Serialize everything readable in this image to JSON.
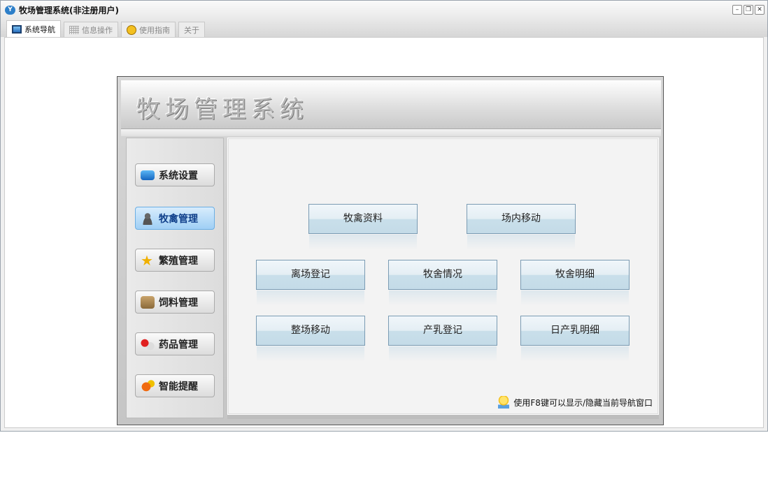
{
  "window": {
    "title": "牧场管理系统(非注册用户)",
    "controls": [
      "minimize",
      "restore",
      "close"
    ]
  },
  "tabs": [
    {
      "label": "系统导航",
      "icon": "monitor-icon",
      "active": true
    },
    {
      "label": "信息操作",
      "icon": "grid-icon",
      "active": false
    },
    {
      "label": "使用指南",
      "icon": "help-icon",
      "active": false
    },
    {
      "label": "关于",
      "active": false
    }
  ],
  "banner": {
    "title": "牧场管理系统"
  },
  "sidebar": {
    "items": [
      {
        "label": "系统设置",
        "icon": "monitor-icon"
      },
      {
        "label": "牧禽管理",
        "icon": "user-icon",
        "active": true
      },
      {
        "label": "繁殖管理",
        "icon": "star-icon"
      },
      {
        "label": "饲料管理",
        "icon": "box-icon"
      },
      {
        "label": "药品管理",
        "icon": "pill-icon"
      },
      {
        "label": "智能提醒",
        "icon": "alert-icon"
      }
    ]
  },
  "functions": [
    "牧禽资料",
    "场内移动",
    "离场登记",
    "牧舍情况",
    "牧舍明细",
    "整场移动",
    "产乳登记",
    "日产乳明细"
  ],
  "tip": "使用F8键可以显示/隐藏当前导航窗口"
}
